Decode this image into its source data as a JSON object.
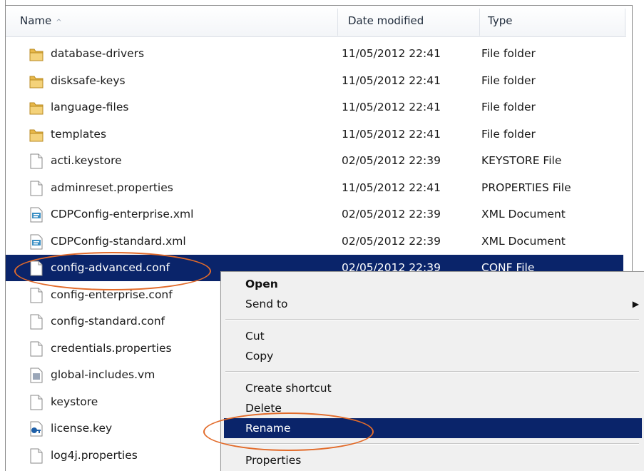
{
  "columns": {
    "name": "Name",
    "date": "Date modified",
    "type": "Type"
  },
  "files": [
    {
      "name": "database-drivers",
      "date": "11/05/2012 22:41",
      "type": "File folder",
      "icon": "folder-icon"
    },
    {
      "name": "disksafe-keys",
      "date": "11/05/2012 22:41",
      "type": "File folder",
      "icon": "folder-icon"
    },
    {
      "name": "language-files",
      "date": "11/05/2012 22:41",
      "type": "File folder",
      "icon": "folder-icon"
    },
    {
      "name": "templates",
      "date": "11/05/2012 22:41",
      "type": "File folder",
      "icon": "folder-icon"
    },
    {
      "name": "acti.keystore",
      "date": "02/05/2012 22:39",
      "type": "KEYSTORE File",
      "icon": "file-icon"
    },
    {
      "name": "adminreset.properties",
      "date": "11/05/2012 22:41",
      "type": "PROPERTIES File",
      "icon": "file-icon"
    },
    {
      "name": "CDPConfig-enterprise.xml",
      "date": "02/05/2012 22:39",
      "type": "XML Document",
      "icon": "xml-file-icon"
    },
    {
      "name": "CDPConfig-standard.xml",
      "date": "02/05/2012 22:39",
      "type": "XML Document",
      "icon": "xml-file-icon"
    },
    {
      "name": "config-advanced.conf",
      "date": "02/05/2012 22:39",
      "type": "CONF File",
      "icon": "file-icon",
      "selected": true
    },
    {
      "name": "config-enterprise.conf",
      "date": "",
      "type": "",
      "icon": "file-icon"
    },
    {
      "name": "config-standard.conf",
      "date": "",
      "type": "",
      "icon": "file-icon"
    },
    {
      "name": "credentials.properties",
      "date": "",
      "type": "",
      "icon": "file-icon"
    },
    {
      "name": "global-includes.vm",
      "date": "",
      "type": "",
      "icon": "vm-file-icon"
    },
    {
      "name": "keystore",
      "date": "",
      "type": "",
      "icon": "file-icon"
    },
    {
      "name": "license.key",
      "date": "",
      "type": "",
      "icon": "key-file-icon"
    },
    {
      "name": "log4j.properties",
      "date": "",
      "type": "",
      "icon": "file-icon"
    }
  ],
  "context_menu": {
    "open": "Open",
    "send_to": "Send to",
    "cut": "Cut",
    "copy": "Copy",
    "create_shortcut": "Create shortcut",
    "delete": "Delete",
    "rename": "Rename",
    "properties": "Properties"
  },
  "colors": {
    "selection": "#0a246a",
    "annotation": "#e26b2a",
    "folder": "#e8b84a"
  }
}
